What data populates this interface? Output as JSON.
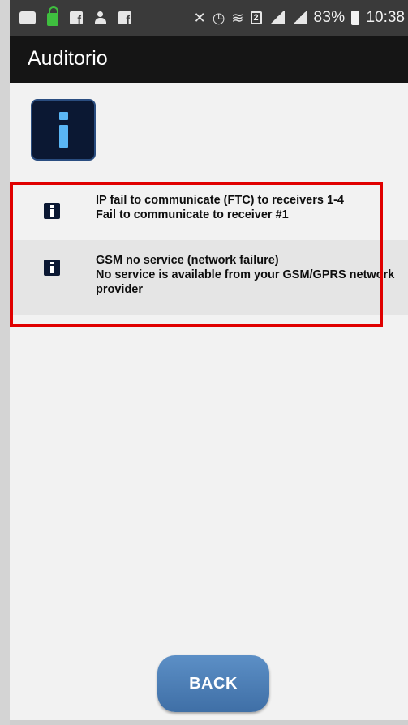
{
  "status_bar": {
    "battery_percent": "83%",
    "time": "10:38",
    "sim_slot": "2",
    "icons": [
      "message-icon",
      "lock-icon",
      "facebook-icon",
      "person-add-icon",
      "facebook-icon",
      "mute-icon",
      "alarm-icon",
      "wifi-icon",
      "sim-icon",
      "signal-icon",
      "data-icon",
      "battery-icon"
    ]
  },
  "app_bar": {
    "title": "Auditorio"
  },
  "alerts": [
    {
      "title": "IP fail to communicate (FTC) to receivers 1-4",
      "detail": "Fail to communicate to receiver #1",
      "icon": "info-icon"
    },
    {
      "title": "GSM no service (network failure)",
      "detail": "No service is available from your GSM/GPRS network provider",
      "icon": "info-icon"
    }
  ],
  "back_button": {
    "label": "BACK"
  },
  "colors": {
    "app_bar": "#151515",
    "status_bar": "#3a3a3a",
    "highlight": "#e00000",
    "button": "#4a7db5",
    "info_icon_bg": "#0b1833",
    "info_icon_fg": "#5ab6f5"
  }
}
